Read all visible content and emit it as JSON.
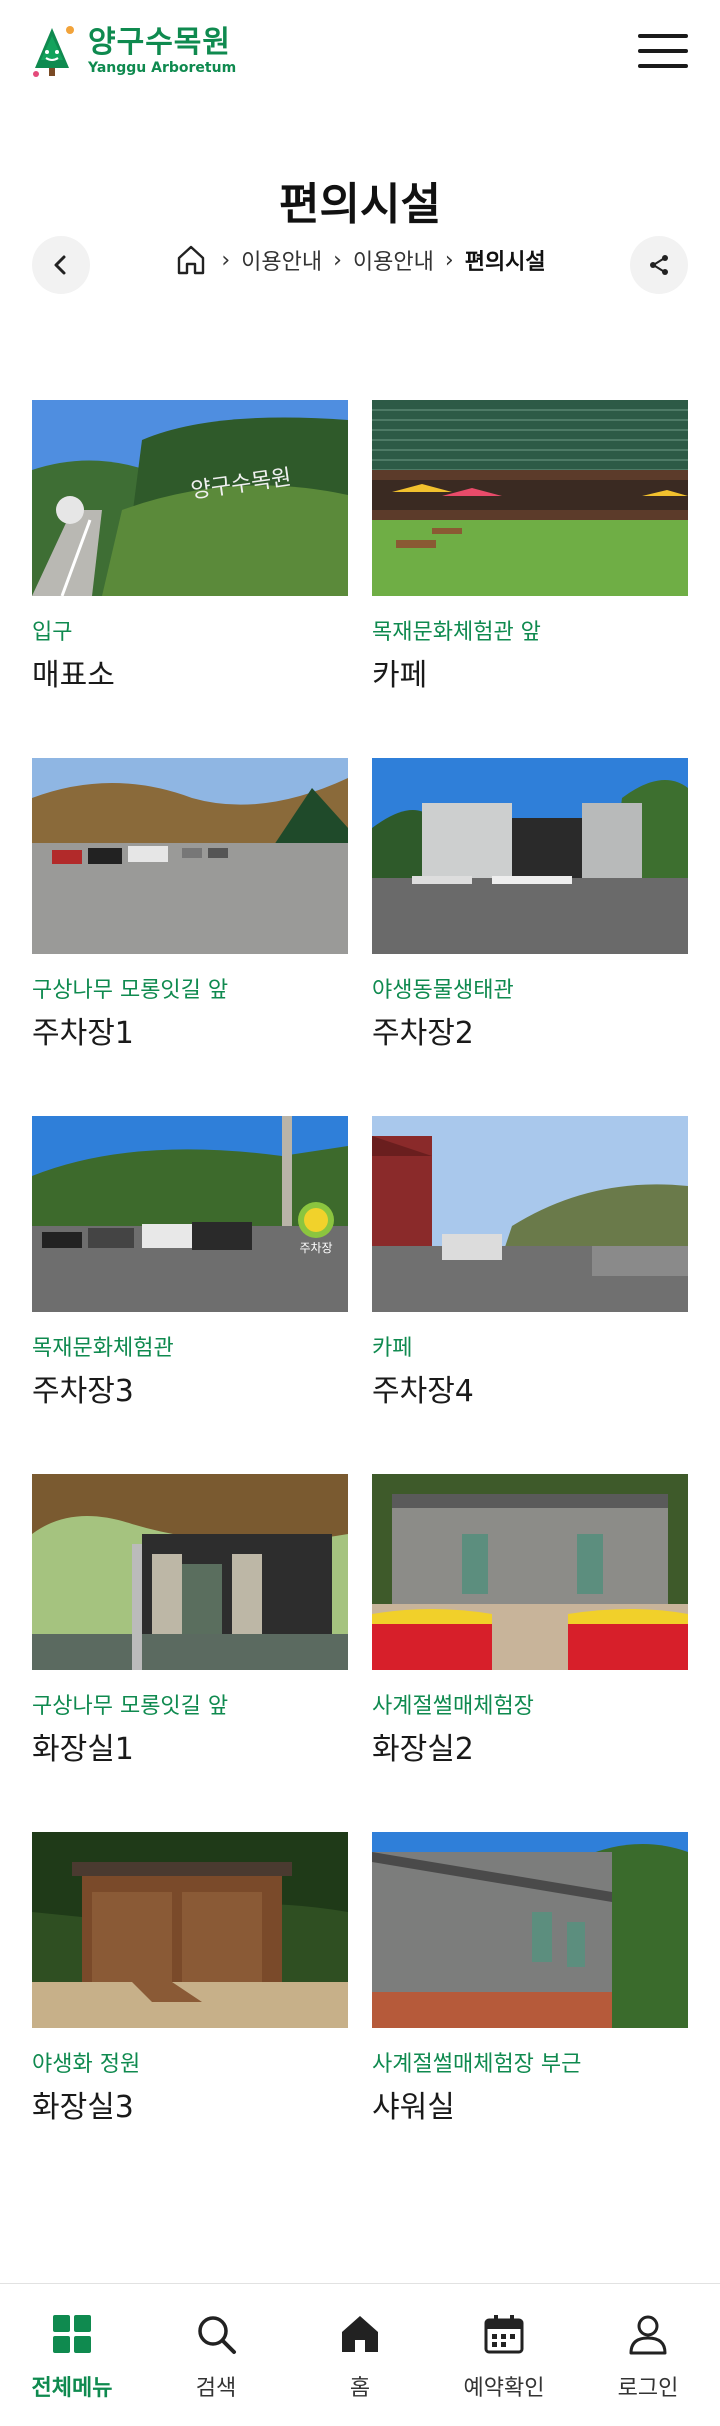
{
  "header": {
    "logo_ko": "양구수목원",
    "logo_en": "Yanggu Arboretum"
  },
  "page": {
    "title": "편의시설"
  },
  "breadcrumb": {
    "items": [
      "이용안내",
      "이용안내",
      "편의시설"
    ]
  },
  "colors": {
    "accent": "#0f8a4f"
  },
  "cards": [
    {
      "sub": "입구",
      "title": "매표소"
    },
    {
      "sub": "목재문화체험관 앞",
      "title": "카페"
    },
    {
      "sub": "구상나무 모롱잇길 앞",
      "title": "주차장1"
    },
    {
      "sub": "야생동물생태관",
      "title": "주차장2"
    },
    {
      "sub": "목재문화체험관",
      "title": "주차장3"
    },
    {
      "sub": "카페",
      "title": "주차장4"
    },
    {
      "sub": "구상나무 모롱잇길 앞",
      "title": "화장실1"
    },
    {
      "sub": "사계절썰매체험장",
      "title": "화장실2"
    },
    {
      "sub": "야생화 정원",
      "title": "화장실3"
    },
    {
      "sub": "사계절썰매체험장 부근",
      "title": "샤워실"
    }
  ],
  "photo_texts": {
    "sign": "양구수목원",
    "parking": "주차장"
  },
  "bottom_nav": [
    {
      "label": "전체메뉴",
      "icon": "grid-icon"
    },
    {
      "label": "검색",
      "icon": "search-icon"
    },
    {
      "label": "홈",
      "icon": "home-icon"
    },
    {
      "label": "예약확인",
      "icon": "calendar-icon"
    },
    {
      "label": "로그인",
      "icon": "user-icon"
    }
  ]
}
